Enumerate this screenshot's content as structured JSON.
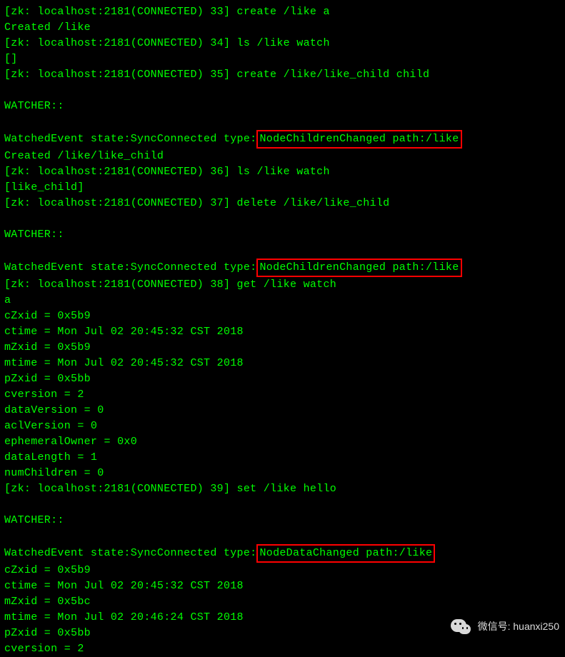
{
  "terminal": {
    "lines": [
      {
        "text": "[zk: localhost:2181(CONNECTED) 33] create /like a"
      },
      {
        "text": "Created /like"
      },
      {
        "text": "[zk: localhost:2181(CONNECTED) 34] ls /like watch"
      },
      {
        "text": "[]"
      },
      {
        "text": "[zk: localhost:2181(CONNECTED) 35] create /like/like_child child"
      },
      {
        "text": ""
      },
      {
        "text": "WATCHER::"
      },
      {
        "text": ""
      },
      {
        "prefix": "WatchedEvent state:SyncConnected type:",
        "highlighted": "NodeChildrenChanged path:/like"
      },
      {
        "text": "Created /like/like_child"
      },
      {
        "text": "[zk: localhost:2181(CONNECTED) 36] ls /like watch"
      },
      {
        "text": "[like_child]"
      },
      {
        "text": "[zk: localhost:2181(CONNECTED) 37] delete /like/like_child"
      },
      {
        "text": ""
      },
      {
        "text": "WATCHER::"
      },
      {
        "text": ""
      },
      {
        "prefix": "WatchedEvent state:SyncConnected type:",
        "highlighted": "NodeChildrenChanged path:/like"
      },
      {
        "text": "[zk: localhost:2181(CONNECTED) 38] get /like watch"
      },
      {
        "text": "a"
      },
      {
        "text": "cZxid = 0x5b9"
      },
      {
        "text": "ctime = Mon Jul 02 20:45:32 CST 2018"
      },
      {
        "text": "mZxid = 0x5b9"
      },
      {
        "text": "mtime = Mon Jul 02 20:45:32 CST 2018"
      },
      {
        "text": "pZxid = 0x5bb"
      },
      {
        "text": "cversion = 2"
      },
      {
        "text": "dataVersion = 0"
      },
      {
        "text": "aclVersion = 0"
      },
      {
        "text": "ephemeralOwner = 0x0"
      },
      {
        "text": "dataLength = 1"
      },
      {
        "text": "numChildren = 0"
      },
      {
        "text": "[zk: localhost:2181(CONNECTED) 39] set /like hello"
      },
      {
        "text": ""
      },
      {
        "text": "WATCHER::"
      },
      {
        "text": ""
      },
      {
        "prefix": "WatchedEvent state:SyncConnected type:",
        "highlighted": "NodeDataChanged path:/like"
      },
      {
        "text": "cZxid = 0x5b9"
      },
      {
        "text": "ctime = Mon Jul 02 20:45:32 CST 2018"
      },
      {
        "text": "mZxid = 0x5bc"
      },
      {
        "text": "mtime = Mon Jul 02 20:46:24 CST 2018"
      },
      {
        "text": "pZxid = 0x5bb"
      },
      {
        "text": "cversion = 2"
      }
    ]
  },
  "watermark": {
    "label": "微信号: huanxi250"
  }
}
